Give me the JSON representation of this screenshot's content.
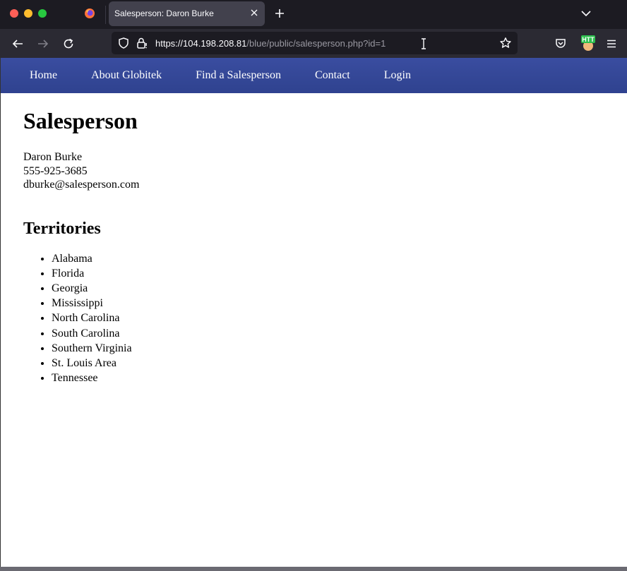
{
  "browser": {
    "tab_title": "Salesperson: Daron Burke",
    "url_host": "https://104.198.208.81",
    "url_path": "/blue/public/salesperson.php?id=1",
    "extension_label": "HTT"
  },
  "site_nav": {
    "items": [
      "Home",
      "About Globitek",
      "Find a Salesperson",
      "Contact",
      "Login"
    ]
  },
  "page": {
    "heading": "Salesperson",
    "name": "Daron Burke",
    "phone": "555-925-3685",
    "email": "dburke@salesperson.com",
    "territories_heading": "Territories",
    "territories": [
      "Alabama",
      "Florida",
      "Georgia",
      "Mississippi",
      "North Carolina",
      "South Carolina",
      "Southern Virginia",
      "St. Louis Area",
      "Tennessee"
    ]
  }
}
